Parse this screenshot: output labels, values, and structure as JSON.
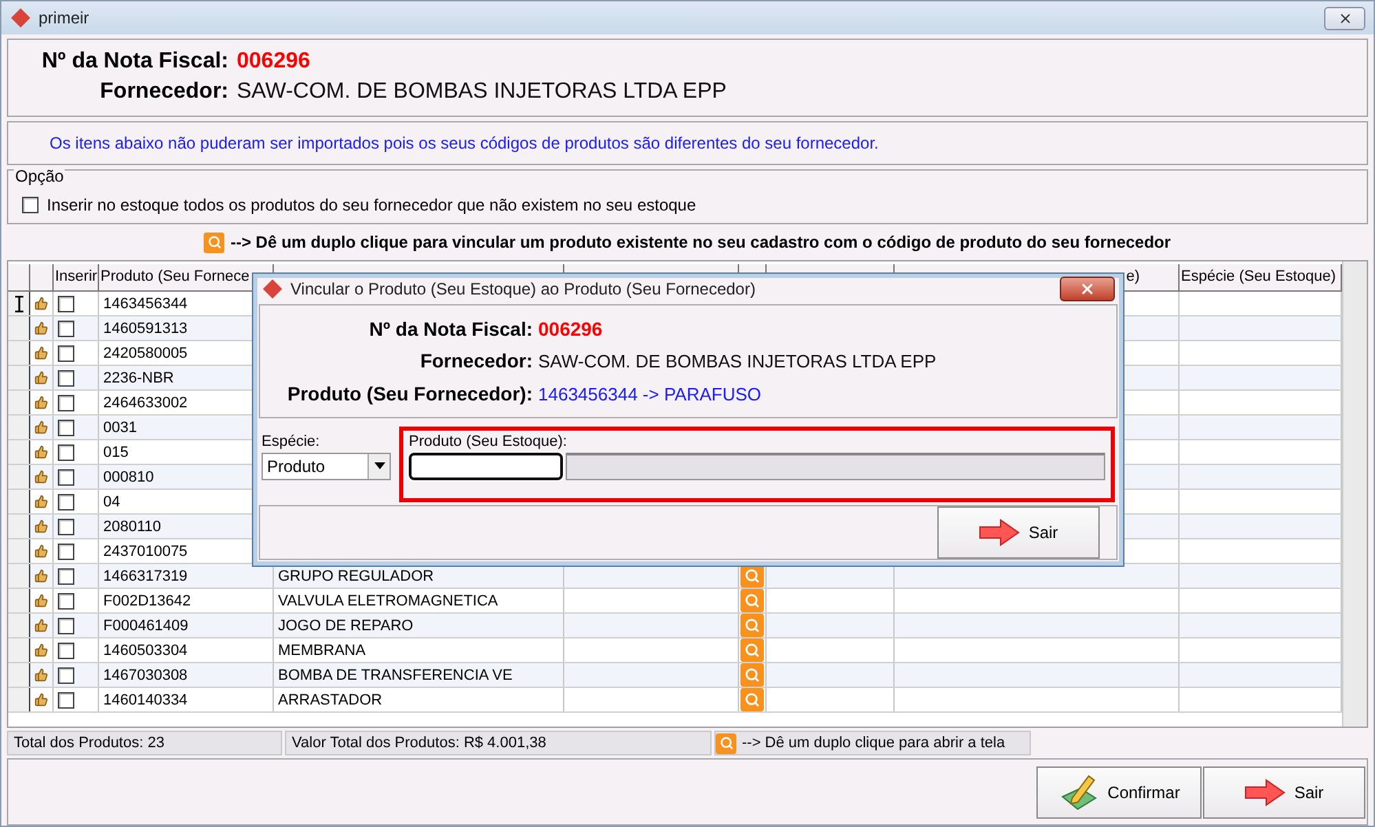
{
  "window": {
    "title": "primeir"
  },
  "header": {
    "nota_label": "Nº da Nota Fiscal:",
    "nota_value": "006296",
    "fornecedor_label": "Fornecedor:",
    "fornecedor_value": "SAW-COM. DE BOMBAS INJETORAS LTDA EPP"
  },
  "message": "Os itens abaixo não puderam ser importados pois os seus códigos de produtos são diferentes do seu fornecedor.",
  "option_group": {
    "legend": "Opção",
    "checkbox": {
      "label": "Inserir no estoque todos os produtos do seu fornecedor que não existem no seu estoque",
      "checked": false
    }
  },
  "hint": "--> Dê um duplo clique para vincular um produto existente no seu cadastro com o código de produto do seu fornecedor",
  "grid": {
    "header": {
      "inserir": "Inserir",
      "produto": "Produto (Seu Fornece",
      "column_9": "e)",
      "especie": "Espécie (Seu Estoque)"
    },
    "rows": [
      {
        "selected": true,
        "inserir": false,
        "produto": "1463456344"
      },
      {
        "selected": false,
        "inserir": false,
        "produto": "1460591313"
      },
      {
        "selected": false,
        "inserir": false,
        "produto": "2420580005"
      },
      {
        "selected": false,
        "inserir": false,
        "produto": "2236-NBR"
      },
      {
        "selected": false,
        "inserir": false,
        "produto": "2464633002"
      },
      {
        "selected": false,
        "inserir": false,
        "produto": "0031"
      },
      {
        "selected": false,
        "inserir": false,
        "produto": "015"
      },
      {
        "selected": false,
        "inserir": false,
        "produto": "000810"
      },
      {
        "selected": false,
        "inserir": false,
        "produto": "04"
      },
      {
        "selected": false,
        "inserir": false,
        "produto": "2080110"
      },
      {
        "selected": false,
        "inserir": false,
        "produto": "2437010075"
      },
      {
        "selected": false,
        "inserir": false,
        "produto": "1466317319",
        "descricao": "GRUPO REGULADOR"
      },
      {
        "selected": false,
        "inserir": false,
        "produto": "F002D13642",
        "descricao": "VALVULA ELETROMAGNETICA"
      },
      {
        "selected": false,
        "inserir": false,
        "produto": "F000461409",
        "descricao": "JOGO DE REPARO"
      },
      {
        "selected": false,
        "inserir": false,
        "produto": "1460503304",
        "descricao": "MEMBRANA"
      },
      {
        "selected": false,
        "inserir": false,
        "produto": "1467030308",
        "descricao": "BOMBA DE TRANSFERENCIA VE"
      },
      {
        "selected": false,
        "inserir": false,
        "produto": "1460140334",
        "descricao": "ARRASTADOR"
      }
    ]
  },
  "status_bar": {
    "total": "Total dos Produtos: 23",
    "valor": "Valor Total dos Produtos: R$ 4.001,38",
    "hint": "--> Dê um duplo clique para abrir a tela"
  },
  "buttons": {
    "confirmar": "Confirmar",
    "sair": "Sair"
  },
  "dialog": {
    "title": "Vincular o Produto (Seu Estoque) ao Produto (Seu Fornecedor)",
    "nota_label": "Nº da Nota Fiscal:",
    "nota_value": "006296",
    "fornecedor_label": "Fornecedor:",
    "fornecedor_value": "SAW-COM. DE BOMBAS INJETORAS LTDA EPP",
    "produto_label": "Produto (Seu Fornecedor):",
    "produto_value": "1463456344 -> PARAFUSO",
    "especie_label": "Espécie:",
    "especie_value": "Produto",
    "estoque_label": "Produto (Seu Estoque):",
    "sair": "Sair"
  }
}
